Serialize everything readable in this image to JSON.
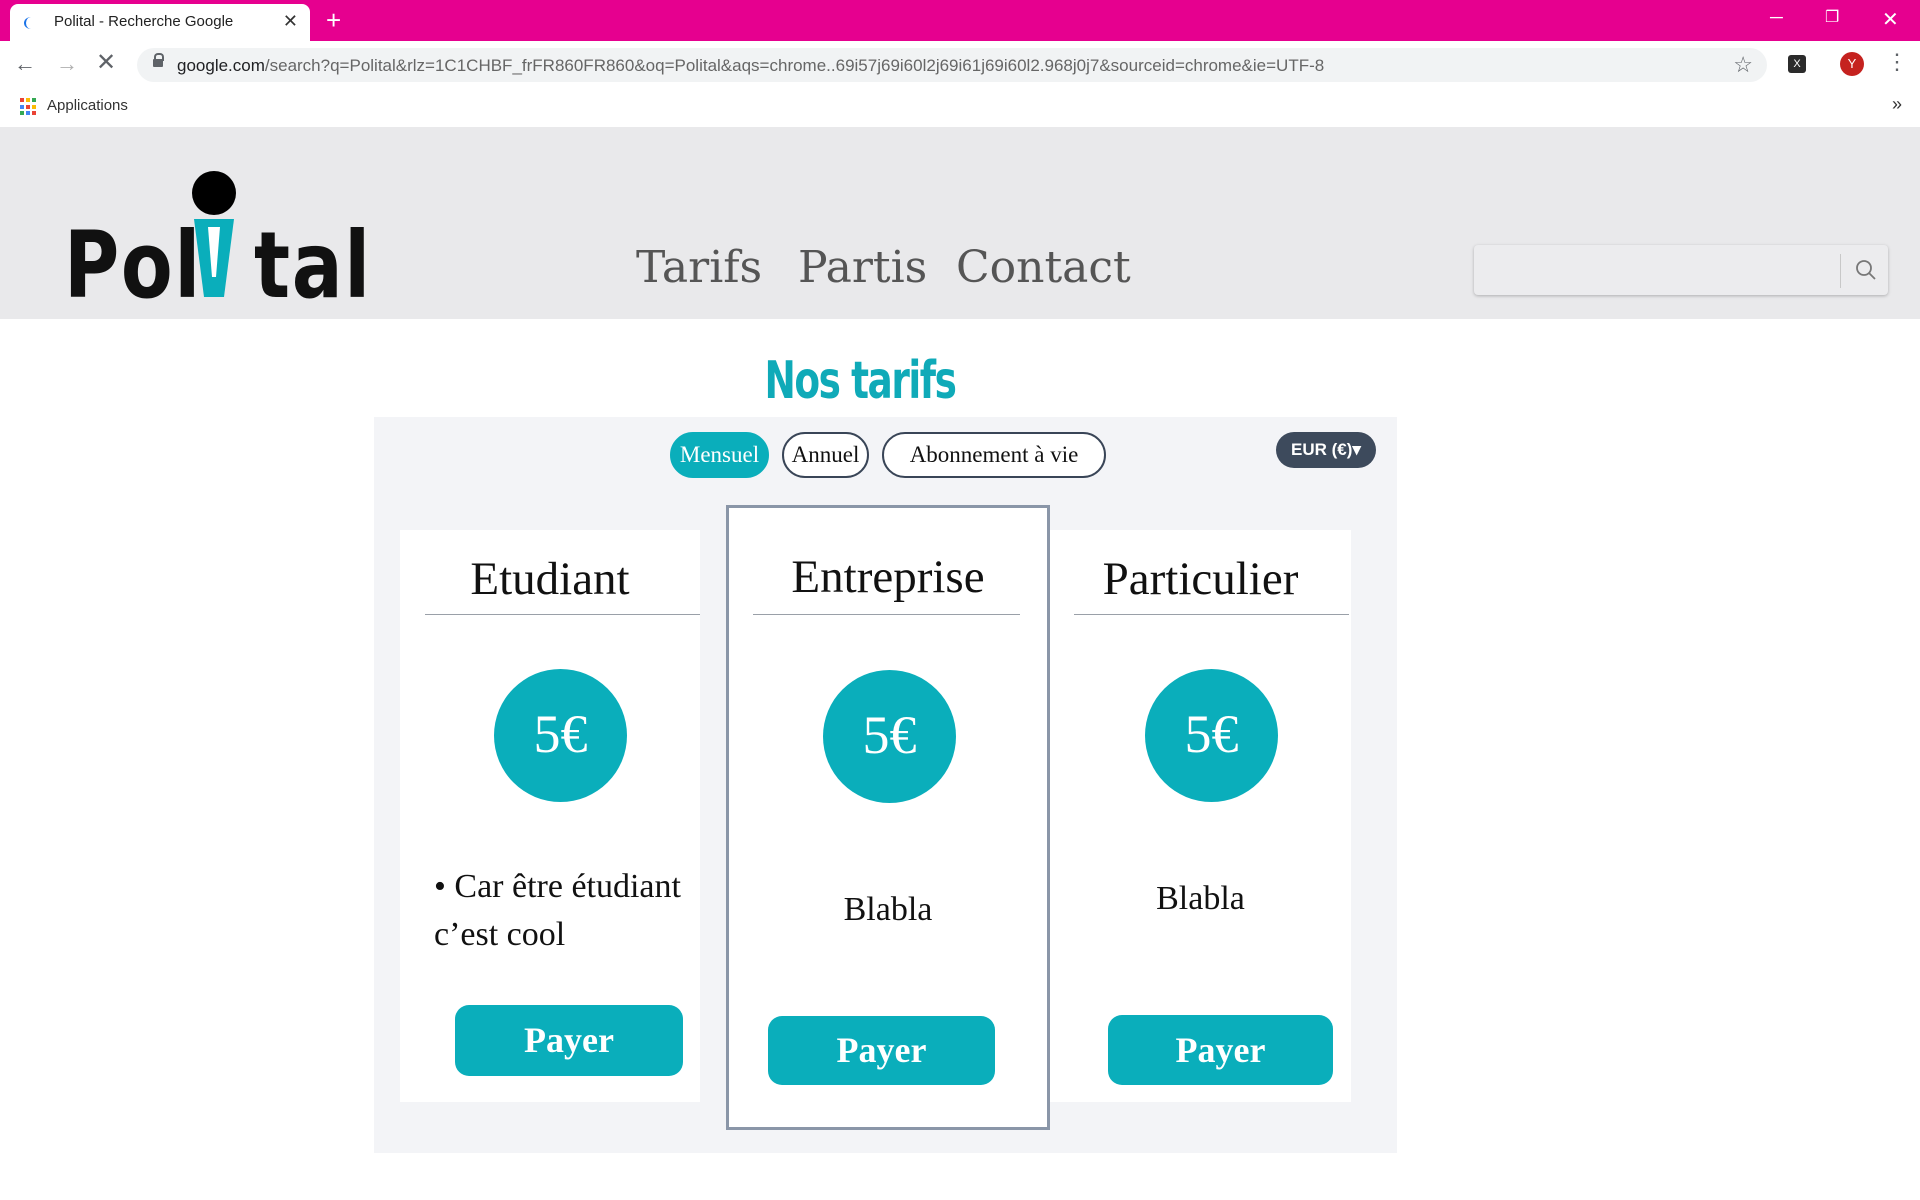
{
  "browser": {
    "tab_title": "Polital - Recherche Google",
    "tab_close": "✕",
    "new_tab": "+",
    "url_host": "google.com",
    "url_rest": "/search?q=Polital&rlz=1C1CHBF_frFR860FR860&oq=Polital&aqs=chrome..69i57j69i60l2j69i61j69i60l2.968j0j7&sourceid=chrome&ie=UTF-8",
    "profile_initial": "Y",
    "extension_label": "X",
    "bookmarks_apps_label": "Applications",
    "bookmarks_more": "»",
    "frame_color": "#e6008f"
  },
  "site": {
    "logo": {
      "left": "Pol",
      "right": "tal"
    },
    "nav": [
      "Tarifs",
      "Partis",
      "Contact"
    ],
    "search_placeholder": ""
  },
  "pricing": {
    "title": "Nos tarifs",
    "periods": [
      {
        "label": "Mensuel",
        "active": true
      },
      {
        "label": "Annuel",
        "active": false
      },
      {
        "label": "Abonnement à vie",
        "active": false
      }
    ],
    "currency": "EUR (€)▾",
    "plans": [
      {
        "name": "Etudiant",
        "price": "5€",
        "description_line1": "• Car être étudiant",
        "description_line2": "c’est cool",
        "button": "Payer"
      },
      {
        "name": "Entreprise",
        "price": "5€",
        "description": "Blabla",
        "button": "Payer"
      },
      {
        "name": "Particulier",
        "price": "5€",
        "description": "Blabla",
        "button": "Payer"
      }
    ],
    "accent_color": "#0aaebb"
  }
}
